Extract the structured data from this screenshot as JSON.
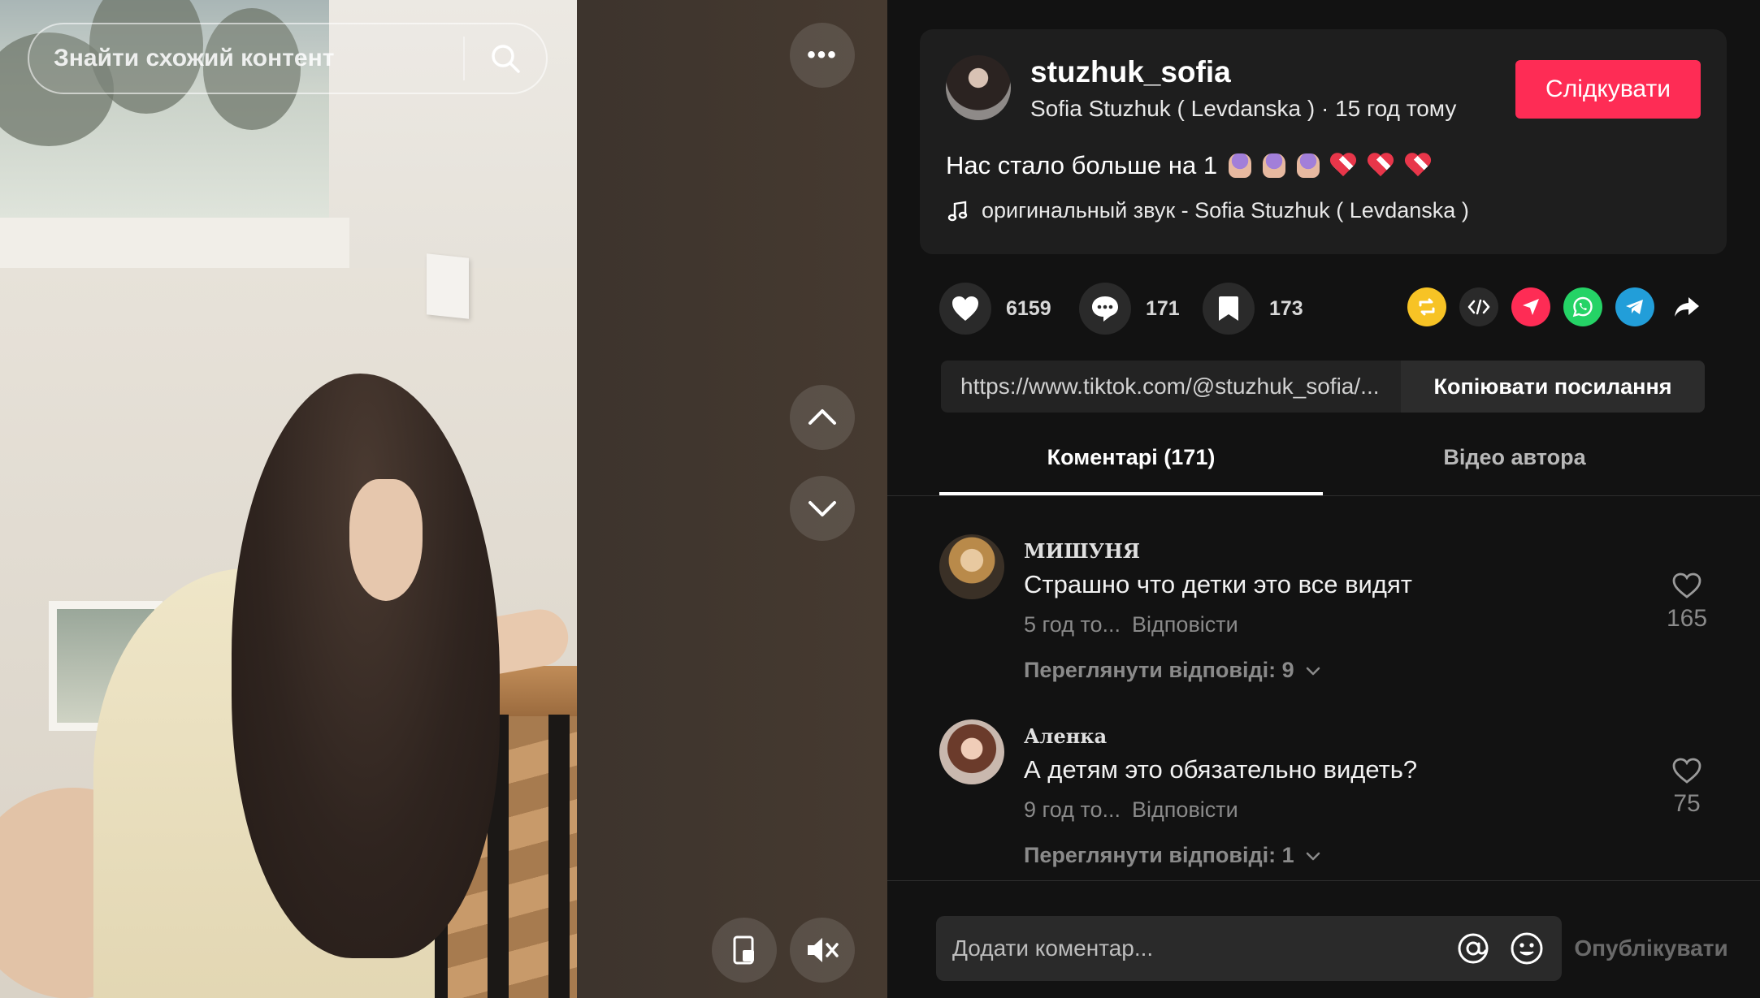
{
  "search": {
    "placeholder": "Знайти схожий контент"
  },
  "video": {
    "more_label": "•••"
  },
  "author": {
    "username": "stuzhuk_sofia",
    "display_name": "Sofia Stuzhuk ( Levdanska )",
    "separator": " · ",
    "time_ago": "15 год тому",
    "follow_label": "Слідкувати"
  },
  "post": {
    "caption": "Нас стало больше на 1",
    "caption_emojis": [
      "folded-hands",
      "folded-hands",
      "folded-hands",
      "heart",
      "heart",
      "heart"
    ],
    "music": "оригинальный звук - Sofia Stuzhuk ( Levdanska )"
  },
  "stats": {
    "likes": "6159",
    "comments": "171",
    "saves": "173"
  },
  "share": {
    "icons": [
      "repost-icon",
      "embed-icon",
      "send-icon",
      "whatsapp-icon",
      "telegram-icon",
      "share-arrow-icon"
    ],
    "colors": {
      "repost": "#f7c325",
      "embed": "#2a2a2a",
      "send": "#fe2c55",
      "whatsapp": "#25d366",
      "telegram": "#229ed9"
    }
  },
  "link": {
    "url": "https://www.tiktok.com/@stuzhuk_sofia/...",
    "copy_label": "Копіювати посилання"
  },
  "tabs": [
    {
      "label": "Коментарі (171)",
      "active": true
    },
    {
      "label": "Відео автора",
      "active": false
    }
  ],
  "comments": [
    {
      "user": "МИШУНЯ",
      "text": "Страшно что детки это все видят",
      "time": "5 год то...",
      "reply_label": "Відповісти",
      "likes": "165",
      "view_replies": "Переглянути відповіді: 9"
    },
    {
      "user": "Аленка",
      "text": "А детям это обязательно видеть?",
      "time": "9 год то...",
      "reply_label": "Відповісти",
      "likes": "75",
      "view_replies": "Переглянути відповіді: 1"
    }
  ],
  "composer": {
    "placeholder": "Додати коментар...",
    "post_label": "Опублікувати"
  },
  "colors": {
    "accent": "#fe2c55",
    "panel_bg": "#121212",
    "card_bg": "#1e1e1e"
  }
}
